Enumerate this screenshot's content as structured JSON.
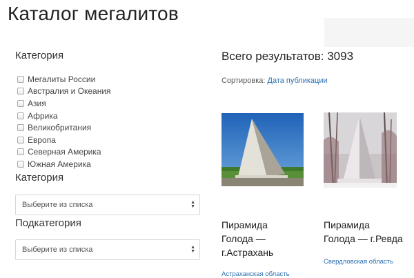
{
  "page": {
    "title": "Каталог мегалитов"
  },
  "sidebar": {
    "category_heading": "Категория",
    "categories": [
      "Мегалиты России",
      "Австралия и Океания",
      "Азия",
      "Африка",
      "Великобритания",
      "Европа",
      "Северная Америка",
      "Южная Америка"
    ],
    "category_select_label": "Категория",
    "category_select_value": "Выберите из списка",
    "subcategory_select_label": "Подкатегория",
    "subcategory_select_value": "Выберите из списка"
  },
  "results": {
    "total_text": "Всего результатов: 3093",
    "sort_label": "Сортировка:",
    "sort_value": "Дата публикации"
  },
  "cards": [
    {
      "title_line1": "Пирамида",
      "title_line2": "Голода —",
      "title_line3": "г.Астрахань",
      "region": "Астраханская область"
    },
    {
      "title_line1": "Пирамида",
      "title_line2": "Голода — г.Ревда",
      "region": "Свердловская область"
    }
  ],
  "icons": {
    "select_arrows": "▲▼"
  }
}
